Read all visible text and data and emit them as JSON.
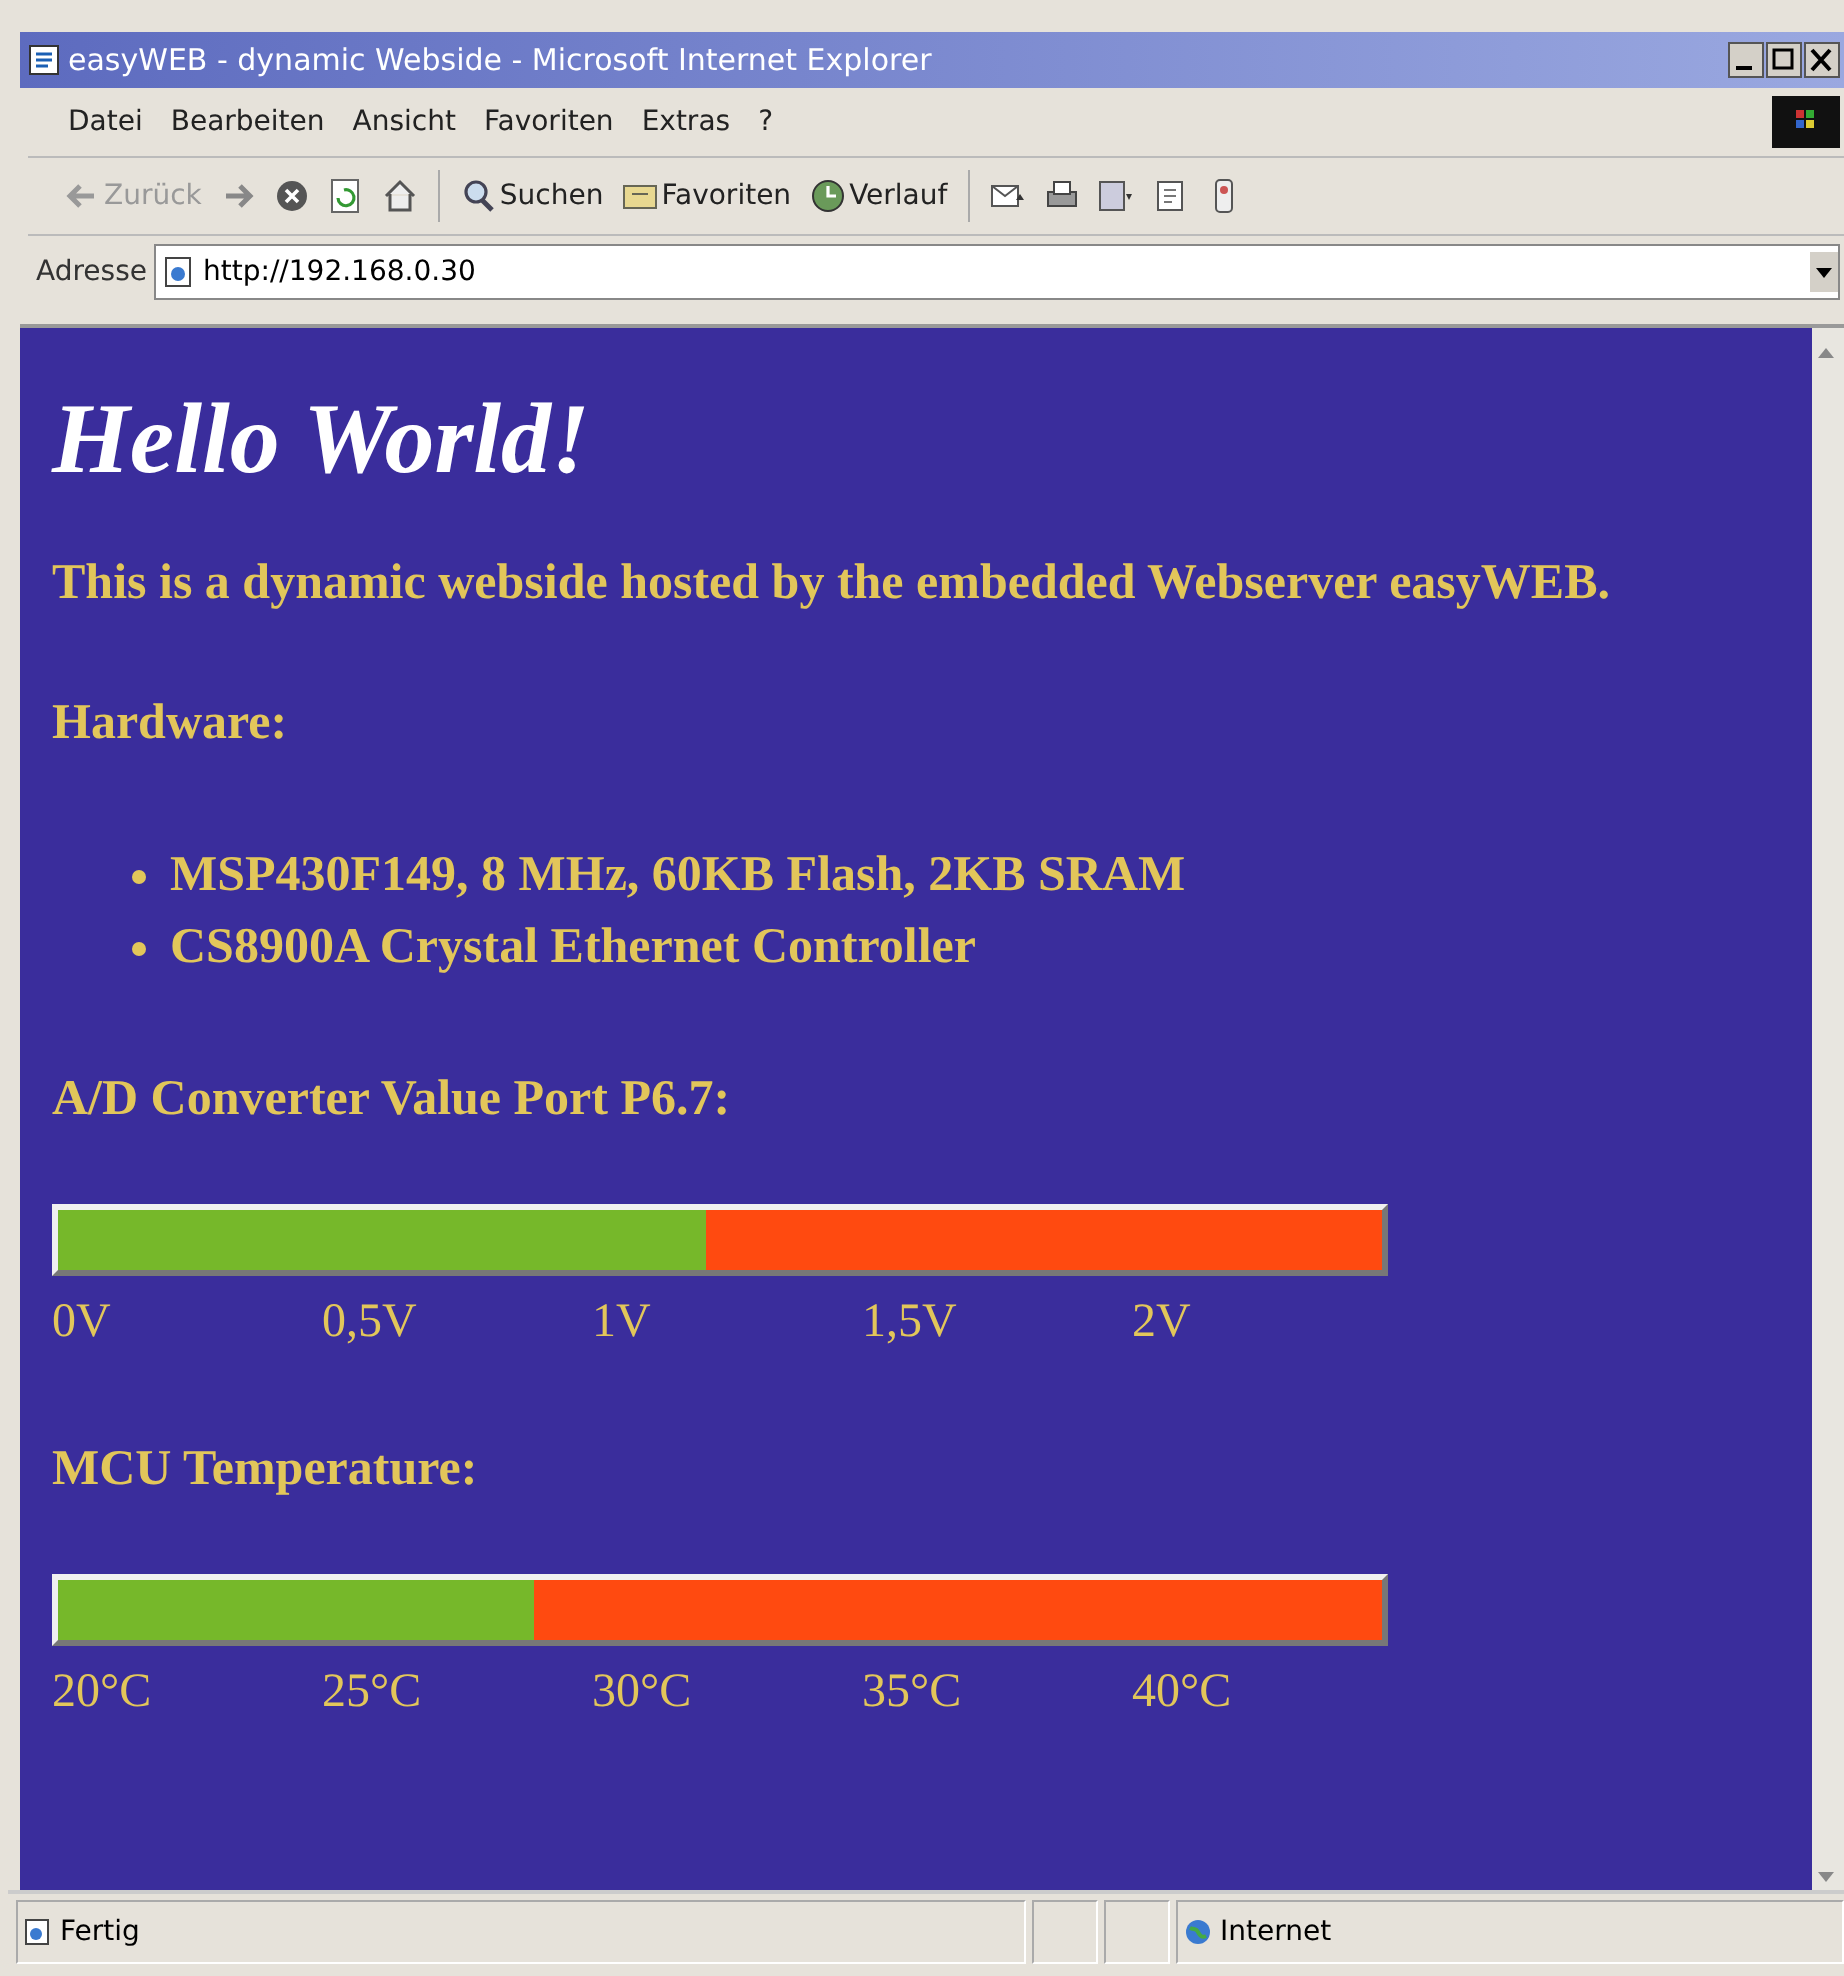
{
  "window": {
    "title": "easyWEB - dynamic Webside - Microsoft Internet Explorer"
  },
  "menu": [
    "Datei",
    "Bearbeiten",
    "Ansicht",
    "Favoriten",
    "Extras",
    "?"
  ],
  "toolbar": [
    {
      "kind": "back",
      "label": "Zurück",
      "disabled": true
    },
    {
      "kind": "forward"
    },
    {
      "kind": "stop"
    },
    {
      "kind": "refresh"
    },
    {
      "kind": "home"
    },
    {
      "kind": "search",
      "label": "Suchen"
    },
    {
      "kind": "favorites",
      "label": "Favoriten"
    },
    {
      "kind": "history",
      "label": "Verlauf"
    },
    {
      "kind": "mail"
    },
    {
      "kind": "print"
    },
    {
      "kind": "edit"
    },
    {
      "kind": "discuss"
    },
    {
      "kind": "messenger"
    }
  ],
  "address": {
    "label": "Adresse",
    "value": "http://192.168.0.30"
  },
  "page": {
    "heading": "Hello World!",
    "intro": "This is a dynamic webside hosted by the embedded Webserver easyWEB.",
    "hardware_heading": "Hardware:",
    "hardware": [
      "MSP430F149, 8 MHz, 60KB Flash, 2KB SRAM",
      "CS8900A Crystal Ethernet Controller"
    ],
    "meters": [
      {
        "title": "A/D Converter Value Port P6.7:",
        "level": 0.49,
        "ticks": [
          "0V",
          "0,5V",
          "1V",
          "1,5V",
          "2V"
        ]
      },
      {
        "title": "MCU Temperature:",
        "level": 0.36,
        "ticks": [
          "20°C",
          "25°C",
          "30°C",
          "35°C",
          "40°C"
        ]
      }
    ]
  },
  "status_bar": {
    "text": "Fertig",
    "zone": "Internet"
  }
}
